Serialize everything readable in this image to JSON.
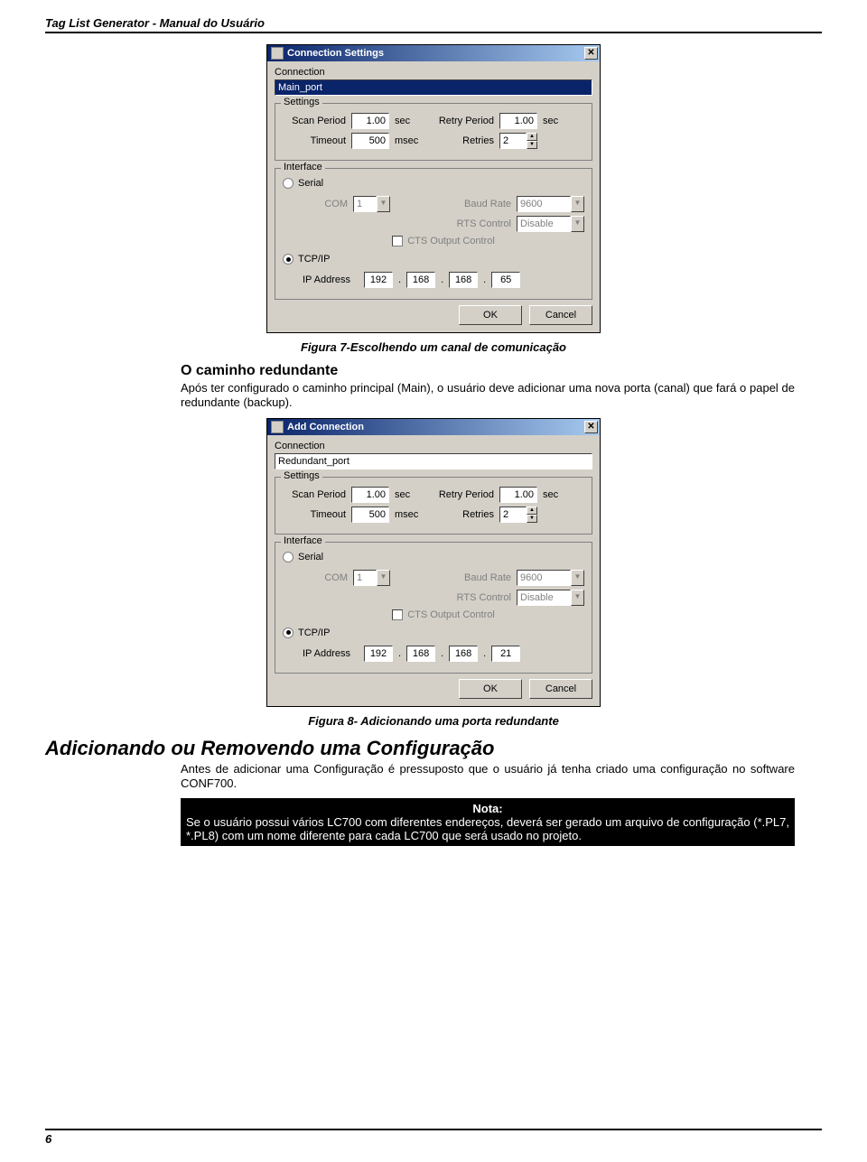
{
  "page": {
    "header": "Tag List Generator - Manual do Usuário",
    "number": "6"
  },
  "dialog1": {
    "title": "Connection Settings",
    "conn_label": "Connection",
    "conn_value": "Main_port",
    "settings_legend": "Settings",
    "scan_label": "Scan Period",
    "scan_value": "1.00",
    "scan_unit": "sec",
    "retry_label": "Retry Period",
    "retry_value": "1.00",
    "retry_unit": "sec",
    "timeout_label": "Timeout",
    "timeout_value": "500",
    "timeout_unit": "msec",
    "retries_label": "Retries",
    "retries_value": "2",
    "iface_legend": "Interface",
    "serial_label": "Serial",
    "com_label": "COM",
    "com_value": "1",
    "baud_label": "Baud Rate",
    "baud_value": "9600",
    "rts_label": "RTS Control",
    "rts_value": "Disable",
    "cts_label": "CTS Output Control",
    "tcp_label": "TCP/IP",
    "ip_label": "IP Address",
    "ip": {
      "a": "192",
      "b": "168",
      "c": "168",
      "d": "65"
    },
    "ok": "OK",
    "cancel": "Cancel"
  },
  "caption1": "Figura 7-Escolhendo um canal de comunicação",
  "section1": {
    "heading": "O caminho redundante",
    "para": "Após ter configurado o caminho principal (Main), o usuário deve adicionar uma nova porta (canal) que fará o papel de redundante (backup)."
  },
  "dialog2": {
    "title": "Add Connection",
    "conn_label": "Connection",
    "conn_value": "Redundant_port",
    "settings_legend": "Settings",
    "scan_label": "Scan Period",
    "scan_value": "1.00",
    "scan_unit": "sec",
    "retry_label": "Retry Period",
    "retry_value": "1.00",
    "retry_unit": "sec",
    "timeout_label": "Timeout",
    "timeout_value": "500",
    "timeout_unit": "msec",
    "retries_label": "Retries",
    "retries_value": "2",
    "iface_legend": "Interface",
    "serial_label": "Serial",
    "com_label": "COM",
    "com_value": "1",
    "baud_label": "Baud Rate",
    "baud_value": "9600",
    "rts_label": "RTS Control",
    "rts_value": "Disable",
    "cts_label": "CTS Output Control",
    "tcp_label": "TCP/IP",
    "ip_label": "IP Address",
    "ip": {
      "a": "192",
      "b": "168",
      "c": "168",
      "d": "21"
    },
    "ok": "OK",
    "cancel": "Cancel"
  },
  "caption2": "Figura 8- Adicionando uma porta redundante",
  "section2": {
    "heading": "Adicionando ou Removendo uma Configuração",
    "para": "Antes de adicionar uma Configuração é pressuposto que o usuário já tenha criado uma configuração no software CONF700.",
    "note_title": "Nota:",
    "note_body": "Se o usuário possui vários LC700 com diferentes endereços, deverá ser gerado um arquivo de configuração (*.PL7, *.PL8) com um nome diferente para cada LC700 que será usado no projeto."
  }
}
